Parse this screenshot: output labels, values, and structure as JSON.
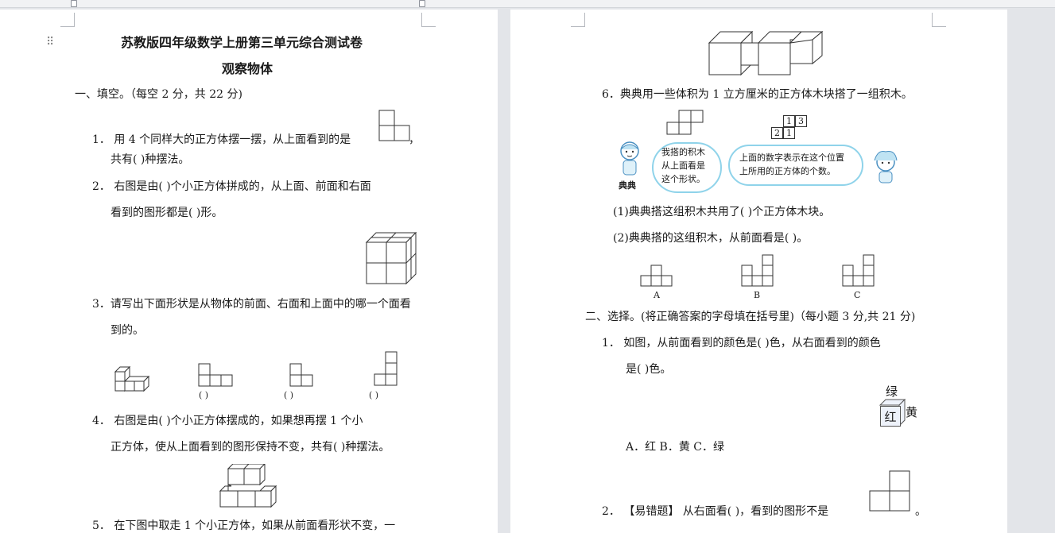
{
  "toolbar": {
    "drag_handle": "⠿"
  },
  "page1": {
    "title": "苏教版四年级数学上册第三单元综合测试卷",
    "subtitle": "观察物体",
    "section1": "一、填空。（每空 2 分，共 22 分)",
    "q1_a": "1．    用 4 个同样大的正方体摆一摆，从上面看到的是",
    "q1_comma": "，",
    "q1_b": "共有(        )种摆法。",
    "q2_a": "2．    右图是由(        )个小正方体拼成的，从上面、前面和右面",
    "q2_b": "看到的图形都是(        )形。",
    "q3_a": "3．请写出下面形状是从物体的前面、右面和上面中的哪一个面看",
    "q3_b": "到的。",
    "q3_blank1": "(        )",
    "q3_blank2": "(        )",
    "q3_blank3": "(        )",
    "q4_a": "4．    右图是由(        )个小正方体摆成的，如果想再摆 1 个小",
    "q4_b": "正方体，使从上面看到的图形保持不变，共有(        )种摆法。",
    "q5_a": "5．    在下图中取走 1 个小正方体，如果从前面看形状不变，一"
  },
  "page2": {
    "q6": "6．典典用一些体积为 1 立方厘米的正方体木块搭了一组积木。",
    "grid_nums": [
      "1",
      "3",
      "2",
      "1"
    ],
    "speaker": "典典",
    "bubble_left": [
      "我搭的积木",
      "从上面看是",
      "这个形状。"
    ],
    "bubble_right": [
      "上面的数字表示在这个位置",
      "上所用的正方体的个数。"
    ],
    "q6_1": "(1)典典搭这组积木共用了(        )个正方体木块。",
    "q6_2": "(2)典典搭的这组积木，从前面看是(        )。",
    "opt_a": "A",
    "opt_b": "B",
    "opt_c": "C",
    "section2": "二、选择。(将正确答案的字母填在括号里)（每小题 3 分,共 21 分)",
    "s2_q1_a": "1．    如图，从前面看到的颜色是(        )色，从右面看到的颜色",
    "s2_q1_b": "是(        )色。",
    "cube_top": "绿",
    "cube_front": "红",
    "cube_right": "黄",
    "s2_q1_opts": "A．红    B．黄    C．绿",
    "s2_q2": "2．  【易错题】 从右面看(        )，看到的图形不是",
    "s2_q2_end": "。"
  }
}
